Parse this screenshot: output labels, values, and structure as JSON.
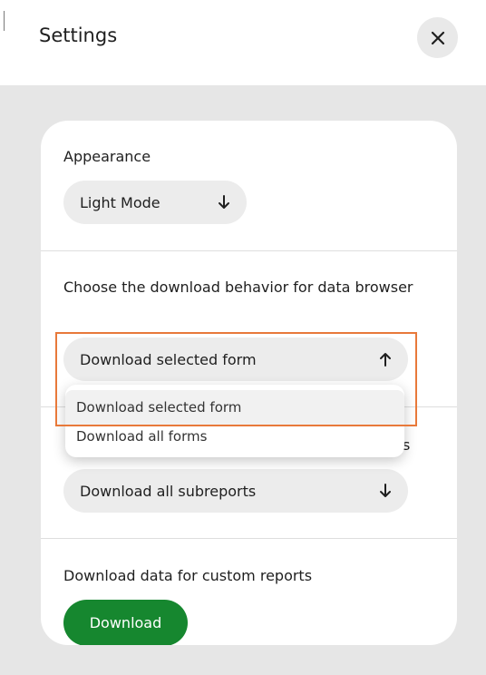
{
  "header": {
    "title": "Settings",
    "close_icon": "close-icon"
  },
  "appearance": {
    "label": "Appearance",
    "selected": "Light Mode",
    "arrow_icon": "arrow-down-icon"
  },
  "download_behavior": {
    "label": "Choose the download behavior for data browser",
    "selected": "Download selected form",
    "arrow_icon": "arrow-up-icon",
    "options": [
      "Download selected form",
      "Download all forms"
    ]
  },
  "subreports": {
    "label_overflow": "s",
    "selected": "Download all subreports",
    "arrow_icon": "arrow-down-icon"
  },
  "custom_reports": {
    "label": "Download data for custom reports",
    "button_label": "Download"
  },
  "colors": {
    "accent_green": "#16872f",
    "highlight_orange": "#e8793a",
    "background_gray": "#e6e6e6"
  }
}
